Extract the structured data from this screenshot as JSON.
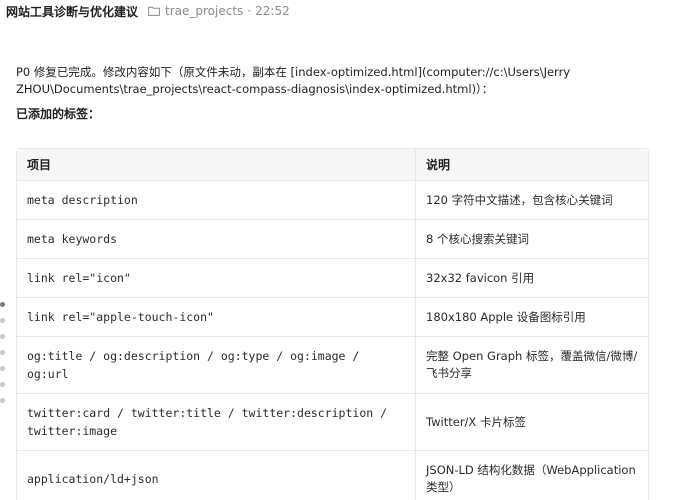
{
  "header": {
    "title": "网站工具诊断与优化建议",
    "project": "trae_projects",
    "separator": "·",
    "time": "22:52"
  },
  "message": {
    "intro": "P0 修复已完成。修改内容如下（原文件未动，副本在 [index-optimized.html](computer://c:\\Users\\Jerry ZHOU\\Documents\\trae_projects\\react-compass-diagnosis\\index-optimized.html)）：",
    "section_title": "已添加的标签："
  },
  "table": {
    "headers": [
      "项目",
      "说明"
    ],
    "rows": [
      {
        "item": "meta description",
        "desc": "120 字符中文描述，包含核心关键词"
      },
      {
        "item": "meta keywords",
        "desc": "8 个核心搜索关键词"
      },
      {
        "item": "link rel=\"icon\"",
        "desc": "32x32 favicon 引用"
      },
      {
        "item": "link rel=\"apple-touch-icon\"",
        "desc": "180x180 Apple 设备图标引用"
      },
      {
        "item": "og:title / og:description / og:type / og:image / og:url",
        "desc": "完整 Open Graph 标签，覆盖微信/微博/飞书分享"
      },
      {
        "item": "twitter:card / twitter:title / twitter:description / twitter:image",
        "desc": "Twitter/X 卡片标签"
      },
      {
        "item": "application/ld+json",
        "desc": "JSON-LD 结构化数据（WebApplication 类型）"
      }
    ]
  },
  "icons": {
    "project": "folder-icon"
  }
}
